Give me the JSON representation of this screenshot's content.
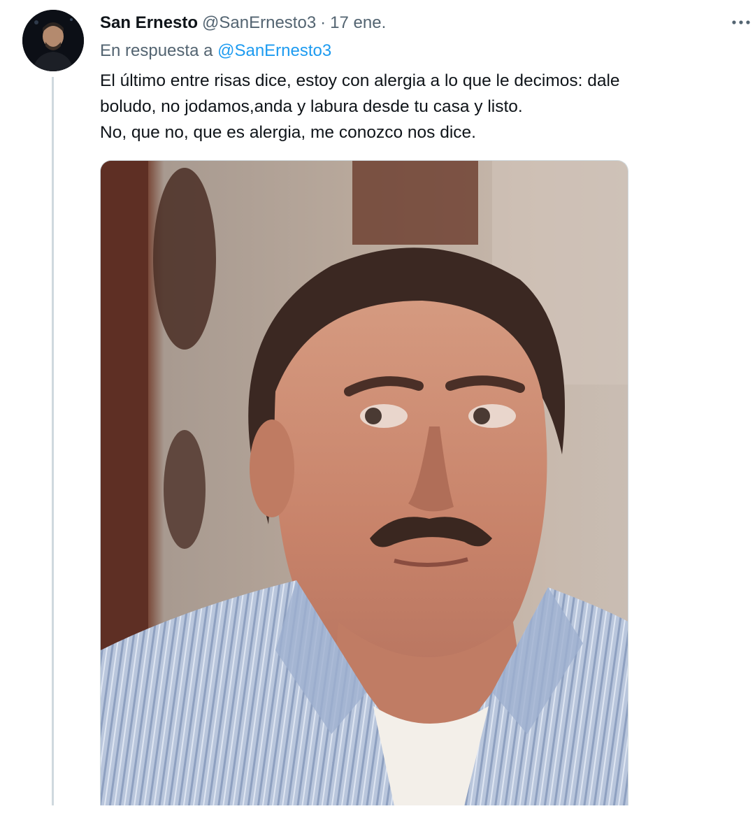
{
  "tweet": {
    "author": {
      "display_name": "San Ernesto",
      "handle": "@SanErnesto3",
      "avatar_icon": "user-avatar-photo"
    },
    "separator": "·",
    "date": "17 ene.",
    "more_icon": "more-horizontal-icon",
    "reply_to": {
      "label": "En respuesta a",
      "mention": "@SanErnesto3"
    },
    "text_lines": [
      "El último entre risas dice, estoy con alergia a lo que le decimos: dale",
      "boludo, no jodamos,anda y labura desde tu casa y listo.",
      "No, que no, que es alergia, me conozco nos dice."
    ],
    "media": {
      "type": "photo",
      "description_icon": "meme-photo"
    },
    "colors": {
      "text": "#0f1419",
      "secondary": "#536471",
      "link": "#1d9bf0",
      "thread_line": "#cfd9de"
    }
  }
}
